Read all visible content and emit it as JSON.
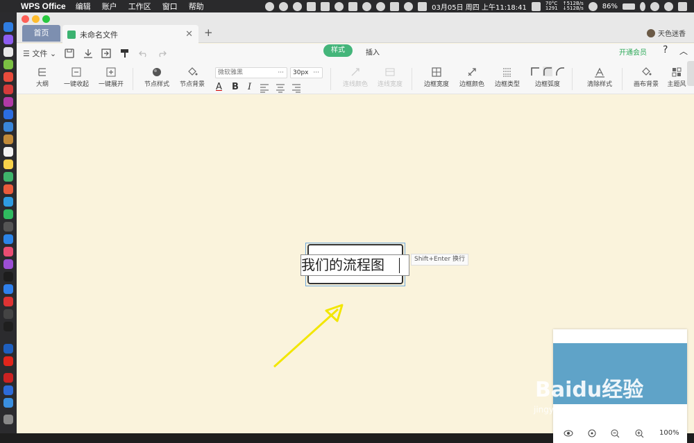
{
  "menubar": {
    "app_name": "WPS Office",
    "items": [
      "编辑",
      "账户",
      "工作区",
      "窗口",
      "帮助"
    ],
    "datetime": "03月05日 周四 上午11:18:41",
    "temp": "70°C",
    "rpm": "1291",
    "net_up": "↑512B/s",
    "net_down": "↓512B/s",
    "battery": "86%"
  },
  "tabs": {
    "home": "首页",
    "doc": "未命名文件",
    "add": "+"
  },
  "user": {
    "name": "天色迷香"
  },
  "row1": {
    "file": "文件",
    "style_tab": "样式",
    "insert_tab": "插入",
    "vip": "开通会员",
    "help": "?"
  },
  "toolbar": {
    "outline": "大纲",
    "collapse_all": "一键收起",
    "expand_all": "一键展开",
    "node_style": "节点样式",
    "node_bg": "节点背景",
    "font": "微软雅黑",
    "font_size": "30px",
    "line_color": "连线颜色",
    "line_width": "连线宽度",
    "border_width": "边框宽度",
    "border_color": "边框颜色",
    "border_type": "边框类型",
    "border_radius": "边框弧度",
    "clear_style": "清除样式",
    "canvas_bg": "画布背景",
    "theme": "主题风"
  },
  "canvas": {
    "node_text": "我们的流程图",
    "hint": "Shift+Enter 换行"
  },
  "minimap": {
    "zoom": "100%"
  },
  "watermark": {
    "brand": "Baidu经验",
    "url": "jingyan.baidu.com"
  },
  "colors": {
    "accent": "#44b57a",
    "canvas_bg": "#faf3dc",
    "arrow": "#f2e600",
    "minimap_view": "#5fa3c8"
  }
}
